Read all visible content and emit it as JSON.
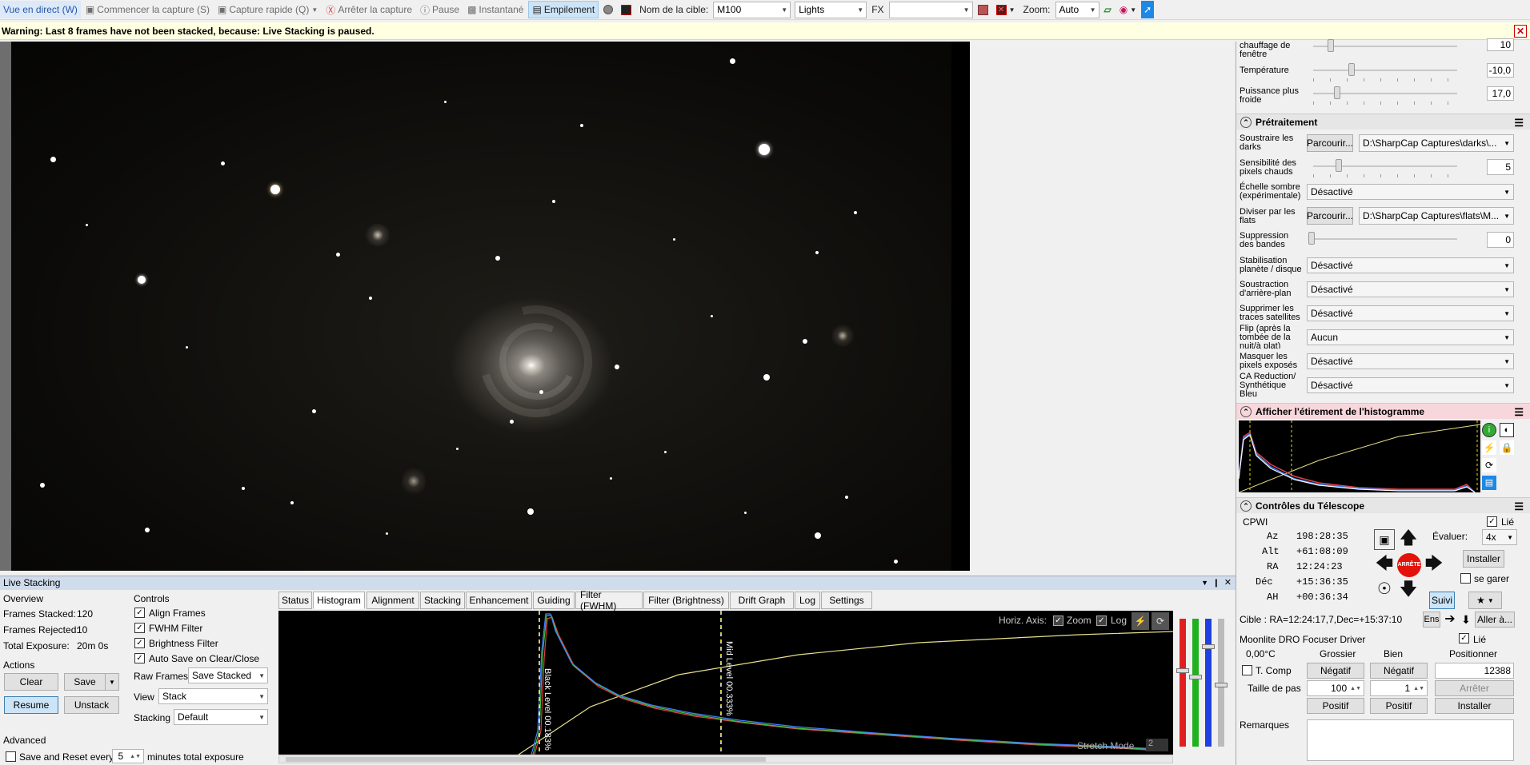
{
  "toolbar": {
    "live_view": "Vue en direct (W)",
    "start_capture": "Commencer la capture (S)",
    "quick_capture": "Capture rapide (Q)",
    "stop_capture": "Arrêter la capture",
    "pause": "Pause",
    "snapshot": "Instantané",
    "stacking": "Empilement",
    "target_name_label": "Nom de la cible:",
    "target_name_value": "M100",
    "frame_type_value": "Lights",
    "fx_label": "FX",
    "fx_value": "",
    "zoom_label": "Zoom:",
    "zoom_value": "Auto"
  },
  "warning": {
    "text": "Warning: Last 8 frames have not been stacked, because: Live Stacking is paused."
  },
  "live_stacking": {
    "title": "Live Stacking",
    "overview": {
      "heading": "Overview",
      "frames_stacked_label": "Frames Stacked:",
      "frames_stacked_value": "120",
      "frames_rejected_label": "Frames Rejected:",
      "frames_rejected_value": "10",
      "total_exposure_label": "Total Exposure:",
      "total_exposure_value": "20m 0s"
    },
    "actions": {
      "heading": "Actions",
      "clear": "Clear",
      "save": "Save",
      "resume": "Resume",
      "unstack": "Unstack"
    },
    "advanced": {
      "heading": "Advanced",
      "save_reset_label": "Save and Reset every",
      "save_reset_value": "5",
      "save_reset_suffix": "minutes total exposure"
    },
    "controls": {
      "heading": "Controls",
      "align_frames": "Align Frames",
      "fwhm_filter": "FWHM Filter",
      "brightness_filter": "Brightness Filter",
      "auto_save": "Auto Save on Clear/Close",
      "raw_frames_label": "Raw Frames",
      "raw_frames_value": "Save Stacked",
      "view_label": "View",
      "view_value": "Stack",
      "stacking_label": "Stacking",
      "stacking_value": "Default"
    },
    "tabs": [
      "Status",
      "Histogram",
      "Alignment",
      "Stacking",
      "Enhancement",
      "Guiding",
      "Filter (FWHM)",
      "Filter (Brightness)",
      "Drift Graph",
      "Log",
      "Settings"
    ],
    "active_tab": "Histogram",
    "histogram": {
      "horiz_axis_label": "Horiz. Axis:",
      "zoom_label": "Zoom",
      "log_label": "Log",
      "black_level": "Black Level  00.183%",
      "mid_level": "Mid Level  00.333%",
      "stretch_mode_label": "Stretch Mode",
      "stretch_mode_value": "2"
    }
  },
  "right_panel": {
    "top_rows": [
      {
        "label": "chauffage de fenêtre",
        "value": "10"
      },
      {
        "label": "Température",
        "value": "-10,0"
      },
      {
        "label": "Puissance plus froide",
        "value": "17,0"
      }
    ],
    "preprocessing": {
      "title": "Prétraitement",
      "rows": [
        {
          "label": "Soustraire les darks",
          "button": "Parcourir...",
          "value": "D:\\SharpCap Captures\\darks\\..."
        },
        {
          "label": "Sensibilité des pixels chauds",
          "value": "5"
        },
        {
          "label": "Échelle sombre (expérimentale)",
          "value": "Désactivé"
        },
        {
          "label": "Diviser par les flats",
          "button": "Parcourir...",
          "value": "D:\\SharpCap Captures\\flats\\M..."
        },
        {
          "label": "Suppression des bandes",
          "value": "0"
        },
        {
          "label": "Stabilisation planète / disque",
          "value": "Désactivé"
        },
        {
          "label": "Soustraction d'arrière-plan",
          "value": "Désactivé"
        },
        {
          "label": "Supprimer les traces satellites",
          "value": "Désactivé"
        },
        {
          "label": "Flip (après la tombée de la nuit/à plat)",
          "value": "Aucun"
        },
        {
          "label": "Masquer les pixels exposés",
          "value": "Désactivé"
        },
        {
          "label": "CA Reduction/ Synthétique Bleu",
          "value": "Désactivé"
        }
      ]
    },
    "histogram_section": {
      "title": "Afficher l'étirement de l'histogramme"
    },
    "telescope": {
      "title": "Contrôles du Télescope",
      "mount": "CPWI",
      "linked_label": "Lié",
      "az_label": "Az",
      "az_value": "198:28:35",
      "alt_label": "Alt",
      "alt_value": "+61:08:09",
      "ra_label": "RA",
      "ra_value": "12:24:23",
      "dec_label": "Déc",
      "dec_value": "+15:36:35",
      "ah_label": "AH",
      "ah_value": "+00:36:34",
      "stop_label": "ARRÊTE",
      "rate_label": "Évaluer:",
      "rate_value": "4x",
      "install": "Installer",
      "park_label": "se garer",
      "track": "Suivi",
      "target_text": "Cible : RA=12:24:17,7,Dec=+15:37:10",
      "set_btn": "Ens",
      "goto_btn": "Aller à..."
    },
    "focuser": {
      "title": "Moonlite DRO Focuser Driver",
      "linked_label": "Lié",
      "temp": "0,00°C",
      "coarse": "Grossier",
      "fine": "Bien",
      "position_label": "Positionner",
      "tcomp_label": "T. Comp",
      "negative": "Négatif",
      "negative2": "Négatif",
      "position_value": "12388",
      "step_label": "Taille de pas",
      "step_coarse": "100",
      "step_fine": "1",
      "stop": "Arrêter",
      "positive": "Positif",
      "positive2": "Positif",
      "install": "Installer"
    },
    "notes_label": "Remarques"
  },
  "colors": {
    "accent": "#cce4f7",
    "warning_bg": "#ffffe1",
    "histogram_header_bg": "#f8d7dc",
    "stop_red": "#e3120b"
  }
}
